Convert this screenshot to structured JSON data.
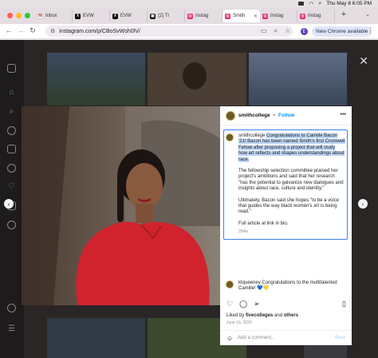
{
  "menubar": {
    "datetime": "Thu May 8  6:05 PM"
  },
  "tabs": [
    {
      "label": "Inbox",
      "color": "#ffffff",
      "glyph": "M",
      "glyph_color": "#d93025",
      "active": false
    },
    {
      "label": "EVW",
      "color": "#000000",
      "glyph": "X",
      "glyph_color": "#ffffff",
      "active": false
    },
    {
      "label": "EVW",
      "color": "#000000",
      "glyph": "X",
      "glyph_color": "#ffffff",
      "active": false
    },
    {
      "label": "(2) Tr",
      "color": "#000000",
      "glyph": "▣",
      "glyph_color": "#ffffff",
      "active": false
    },
    {
      "label": "Instag",
      "color": "#dd2a7b",
      "glyph": "◎",
      "glyph_color": "#ffffff",
      "active": false
    },
    {
      "label": "Smith",
      "color": "#dd2a7b",
      "glyph": "◎",
      "glyph_color": "#ffffff",
      "active": true
    },
    {
      "label": "Instag",
      "color": "#dd2a7b",
      "glyph": "◎",
      "glyph_color": "#ffffff",
      "active": false
    },
    {
      "label": "Instag",
      "color": "#dd2a7b",
      "glyph": "◎",
      "glyph_color": "#ffffff",
      "active": false
    }
  ],
  "toolbar": {
    "url": "instagram.com/p/CBoSvWsh0lV/",
    "profile_initial": "E",
    "new_chrome_label": "New Chrome available"
  },
  "post": {
    "username": "smithcollege",
    "dot": "•",
    "follow_label": "Follow",
    "caption_username": "smithcollege",
    "caption_highlight": "Congratulations to Camille Bacon '21! Bacon has been named Smith's first Cromwell Fellow after proposing a project that will study how art reflects and shapes understandings about race.",
    "caption_p2": "The fellowship selection committee praised her project's ambitions and said that her research \"has the potential to galvanize new dialogues and insights about race, culture and identity.\"",
    "caption_p3": "Ultimately, Bacon said she hopes \"to be a voice that guides the way black women's art is being read.\"",
    "caption_p4": "Full article at link in bio.",
    "caption_time": "254w",
    "comment_user": "ktqueeney",
    "comment_text": "Congratulations to the multitalented Camille! 💙💛",
    "likes_prefix": "Liked by ",
    "likes_user": "fivecolleges",
    "likes_mid": " and ",
    "likes_others": "others",
    "date": "June 19, 2020",
    "add_comment_placeholder": "Add a comment...",
    "post_label": "Post"
  },
  "icons": [
    "instagram-icon",
    "home-icon",
    "search-icon",
    "explore-icon",
    "reels-icon",
    "messages-icon",
    "notifications-icon",
    "create-icon",
    "profile-icon",
    "threads-icon",
    "more-icon",
    "close-icon",
    "like-icon",
    "comment-icon",
    "share-icon",
    "save-icon",
    "emoji-icon"
  ]
}
